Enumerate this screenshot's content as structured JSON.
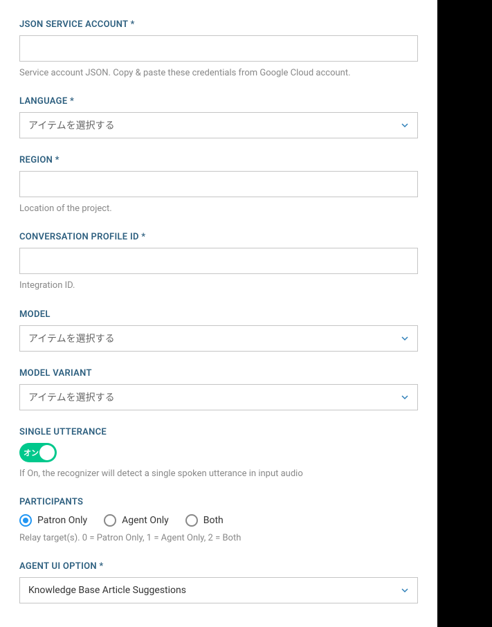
{
  "json_service_account": {
    "label": "JSON SERVICE ACCOUNT *",
    "value": "",
    "help": "Service account JSON. Copy & paste these credentials from Google Cloud account."
  },
  "language": {
    "label": "LANGUAGE *",
    "placeholder": "アイテムを選択する"
  },
  "region": {
    "label": "REGION *",
    "value": "",
    "help": "Location of the project."
  },
  "conversation_profile_id": {
    "label": "CONVERSATION PROFILE ID *",
    "value": "",
    "help": "Integration ID."
  },
  "model": {
    "label": "MODEL",
    "placeholder": "アイテムを選択する"
  },
  "model_variant": {
    "label": "MODEL VARIANT",
    "placeholder": "アイテムを選択する"
  },
  "single_utterance": {
    "label": "SINGLE UTTERANCE",
    "toggle_text": "オン",
    "state": "on",
    "help": "If On, the recognizer will detect a single spoken utterance in input audio"
  },
  "participants": {
    "label": "PARTICIPANTS",
    "options": [
      {
        "label": "Patron Only",
        "selected": true
      },
      {
        "label": "Agent Only",
        "selected": false
      },
      {
        "label": "Both",
        "selected": false
      }
    ],
    "help": "Relay target(s). 0 = Patron Only, 1 = Agent Only, 2 = Both"
  },
  "agent_ui_option": {
    "label": "AGENT UI OPTION *",
    "value": "Knowledge Base Article Suggestions"
  },
  "colors": {
    "label_color": "#2d5f7f",
    "chevron_color": "#2d7fb8",
    "toggle_on": "#00c88c",
    "radio_selected": "#2196f3"
  }
}
